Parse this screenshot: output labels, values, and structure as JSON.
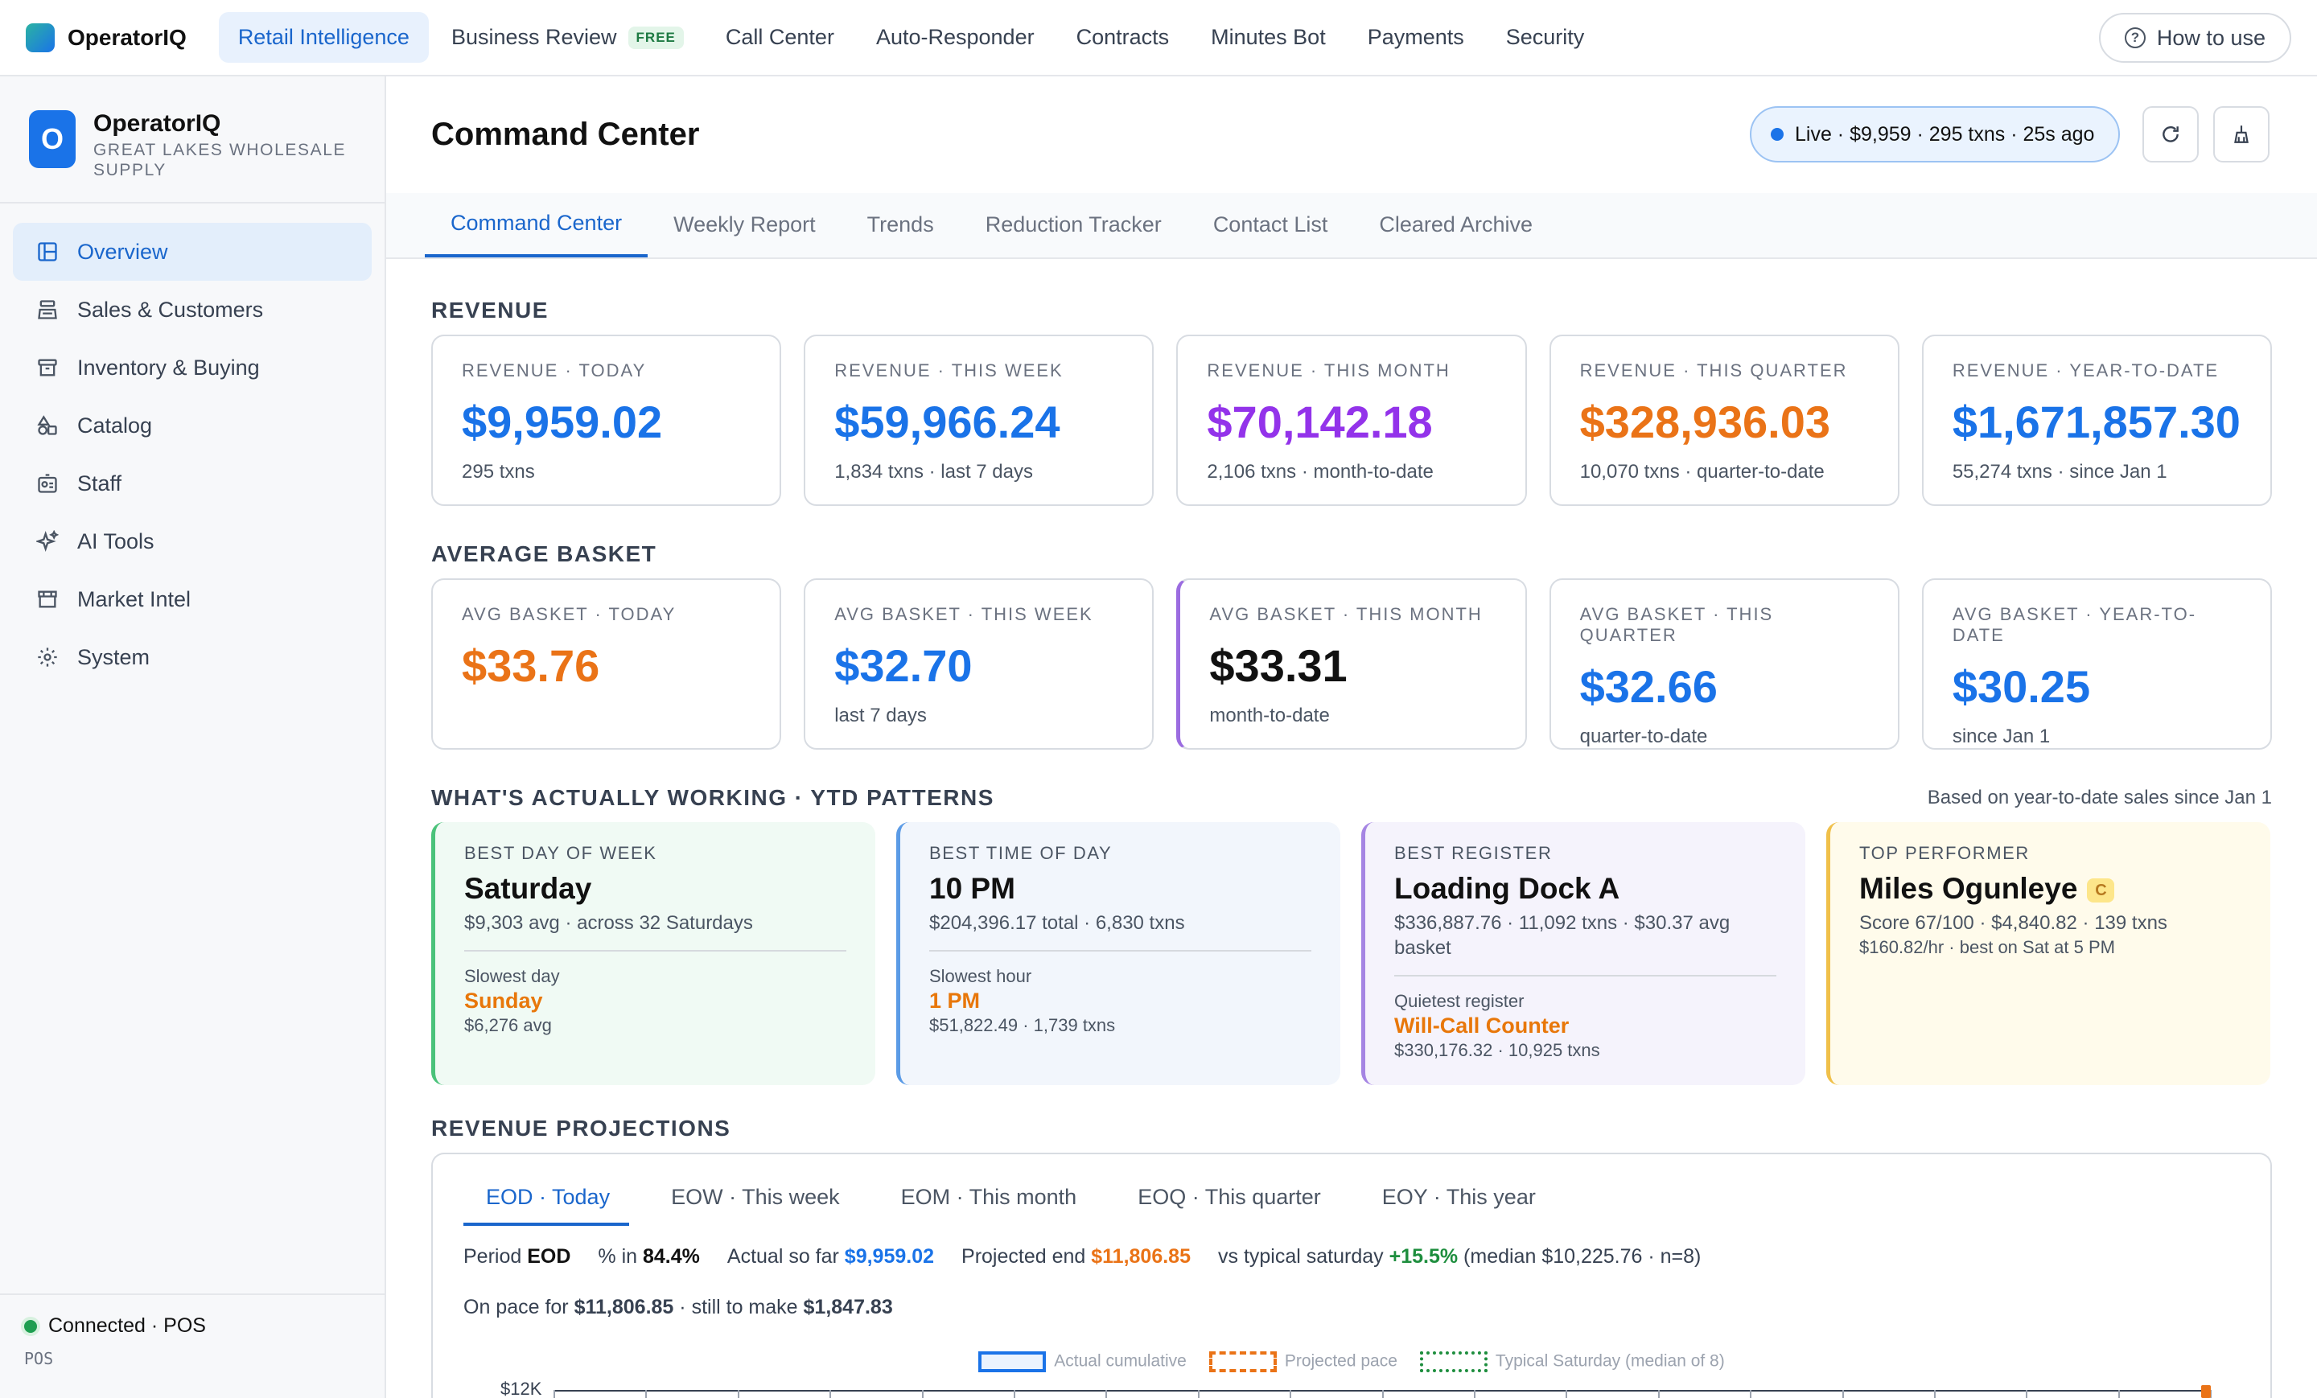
{
  "topnav": {
    "brand": "OperatorIQ",
    "items": [
      {
        "label": "Retail Intelligence",
        "active": true
      },
      {
        "label": "Business Review",
        "badge": "FREE"
      },
      {
        "label": "Call Center"
      },
      {
        "label": "Auto-Responder"
      },
      {
        "label": "Contracts"
      },
      {
        "label": "Minutes Bot"
      },
      {
        "label": "Payments"
      },
      {
        "label": "Security"
      }
    ],
    "help_label": "How to use"
  },
  "sidebar": {
    "org_initial": "O",
    "org_name": "OperatorIQ",
    "org_sub": "GREAT LAKES WHOLESALE SUPPLY",
    "items": [
      {
        "label": "Overview",
        "icon": "layout-icon",
        "active": true
      },
      {
        "label": "Sales & Customers",
        "icon": "register-icon"
      },
      {
        "label": "Inventory & Buying",
        "icon": "archive-icon"
      },
      {
        "label": "Catalog",
        "icon": "shapes-icon"
      },
      {
        "label": "Staff",
        "icon": "id-badge-icon"
      },
      {
        "label": "AI Tools",
        "icon": "sparkles-icon"
      },
      {
        "label": "Market Intel",
        "icon": "store-icon"
      },
      {
        "label": "System",
        "icon": "gear-icon"
      }
    ],
    "footer": {
      "status": "Connected · POS",
      "sub": "POS"
    }
  },
  "header": {
    "title": "Command Center",
    "live_status": "Live · $9,959 · 295 txns · 25s ago"
  },
  "tabs": [
    {
      "label": "Command Center",
      "active": true
    },
    {
      "label": "Weekly Report"
    },
    {
      "label": "Trends"
    },
    {
      "label": "Reduction Tracker"
    },
    {
      "label": "Contact List"
    },
    {
      "label": "Cleared Archive"
    }
  ],
  "revenue": {
    "section": "REVENUE",
    "cards": [
      {
        "label": "REVENUE · TODAY",
        "value": "$9,959.02",
        "sub": "295 txns",
        "color": "#1a73e8"
      },
      {
        "label": "REVENUE · THIS WEEK",
        "value": "$59,966.24",
        "sub": "1,834 txns · last 7 days",
        "color": "#1a73e8"
      },
      {
        "label": "REVENUE · THIS MONTH",
        "value": "$70,142.18",
        "sub": "2,106 txns · month-to-date",
        "color": "#9333ea"
      },
      {
        "label": "REVENUE · THIS QUARTER",
        "value": "$328,936.03",
        "sub": "10,070 txns · quarter-to-date",
        "color": "#ea7317"
      },
      {
        "label": "REVENUE · YEAR-TO-DATE",
        "value": "$1,671,857.30",
        "sub": "55,274 txns · since Jan 1",
        "color": "#1a73e8"
      }
    ]
  },
  "basket": {
    "section": "AVERAGE BASKET",
    "cards": [
      {
        "label": "AVG BASKET · TODAY",
        "value": "$33.76",
        "sub": "",
        "color": "#ea7317"
      },
      {
        "label": "AVG BASKET · THIS WEEK",
        "value": "$32.70",
        "sub": "last 7 days",
        "color": "#1a73e8"
      },
      {
        "label": "AVG BASKET · THIS MONTH",
        "value": "$33.31",
        "sub": "month-to-date",
        "color": "#111111"
      },
      {
        "label": "AVG BASKET · THIS QUARTER",
        "value": "$32.66",
        "sub": "quarter-to-date",
        "color": "#1a73e8"
      },
      {
        "label": "AVG BASKET · YEAR-TO-DATE",
        "value": "$30.25",
        "sub": "since Jan 1",
        "color": "#1a73e8"
      }
    ]
  },
  "insights": {
    "section": "WHAT'S ACTUALLY WORKING · YTD PATTERNS",
    "note": "Based on year-to-date sales since Jan 1",
    "day": {
      "label": "BEST DAY OF WEEK",
      "value": "Saturday",
      "sub": "$9,303 avg · across 32 Saturdays",
      "slow_label": "Slowest day",
      "slow_value": "Sunday",
      "slow_sub": "$6,276 avg"
    },
    "time": {
      "label": "BEST TIME OF DAY",
      "value": "10 PM",
      "sub": "$204,396.17 total · 6,830 txns",
      "slow_label": "Slowest hour",
      "slow_value": "1 PM",
      "slow_sub": "$51,822.49 · 1,739 txns"
    },
    "register": {
      "label": "BEST REGISTER",
      "value": "Loading Dock A",
      "sub": "$336,887.76 · 11,092 txns · $30.37 avg basket",
      "slow_label": "Quietest register",
      "slow_value": "Will-Call Counter",
      "slow_sub": "$330,176.32 · 10,925 txns"
    },
    "performer": {
      "label": "TOP PERFORMER",
      "value": "Miles Ogunleye",
      "badge": "C",
      "sub1": "Score 67/100 · $4,840.82 · 139 txns",
      "sub2": "$160.82/hr · best on Sat at 5 PM"
    }
  },
  "projections": {
    "section": "REVENUE PROJECTIONS",
    "tabs": [
      {
        "label": "EOD · Today",
        "active": true
      },
      {
        "label": "EOW · This week"
      },
      {
        "label": "EOM · This month"
      },
      {
        "label": "EOQ · This quarter"
      },
      {
        "label": "EOY · This year"
      }
    ],
    "period_label": "Period",
    "period_value": "EOD",
    "pct_label": "% in",
    "pct_value": "84.4%",
    "actual_label": "Actual so far",
    "actual_value": "$9,959.02",
    "projected_label": "Projected end",
    "projected_value": "$11,806.85",
    "typical_label": "vs typical saturday",
    "typical_value": "+15.5%",
    "typical_note": "(median $10,225.76 · n=8)",
    "pace_prefix": "On pace for",
    "pace_value": "$11,806.85",
    "pace_mid": "· still to make",
    "pace_remaining": "$1,847.83",
    "legend": [
      "Actual cumulative",
      "Projected pace",
      "Typical Saturday (median of 8)"
    ],
    "y_tick_top": "$12K"
  }
}
